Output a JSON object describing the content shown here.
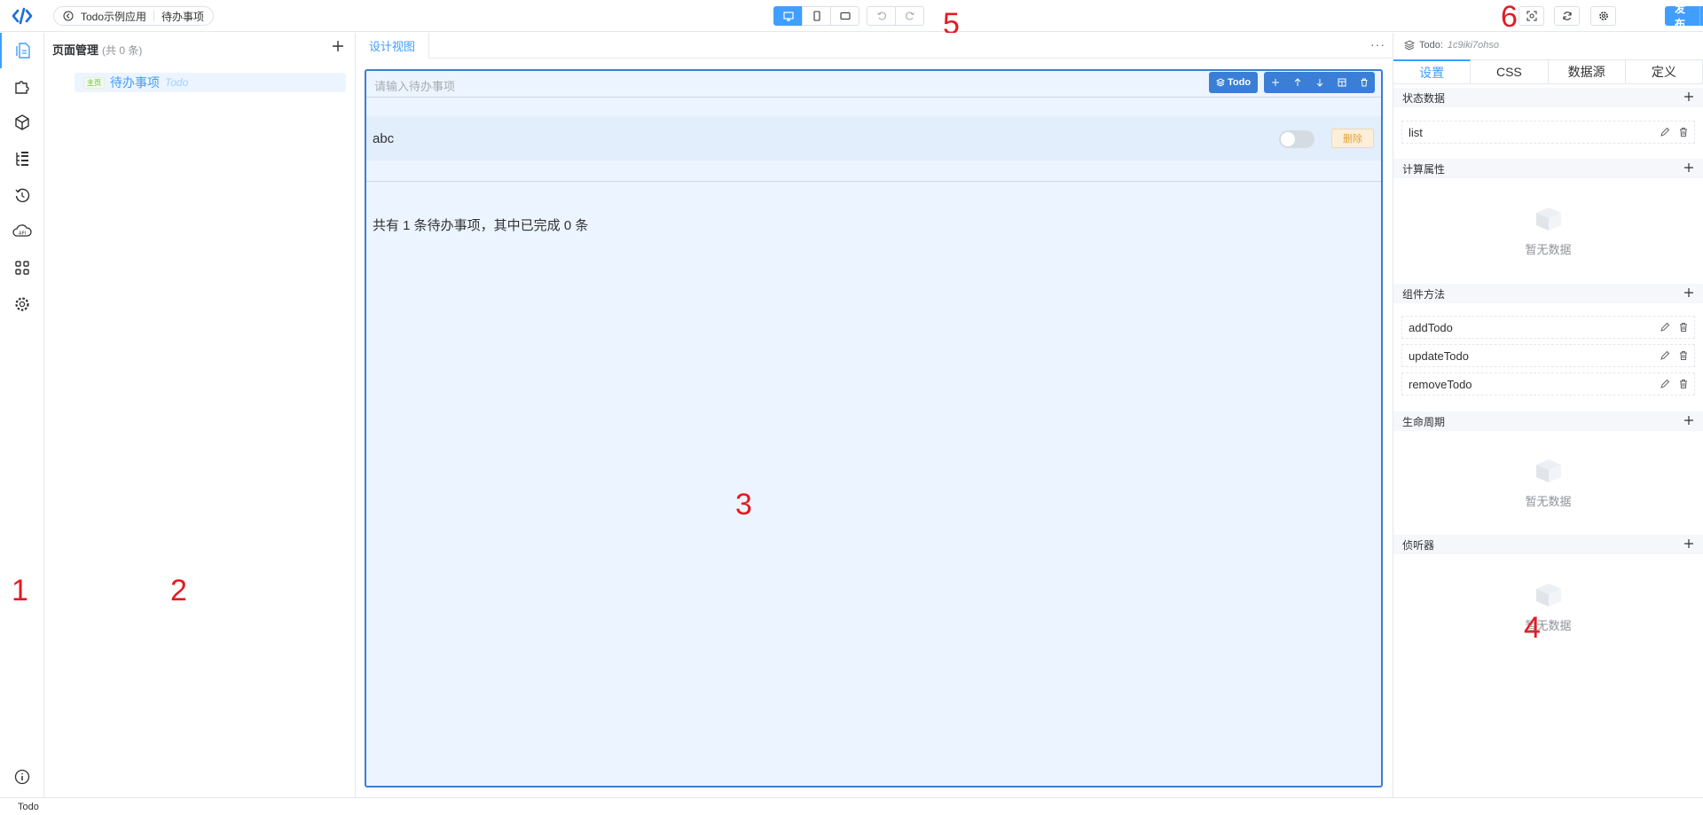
{
  "header": {
    "breadcrumb": {
      "app": "Todo示例应用",
      "page": "待办事项"
    },
    "devices": [
      {
        "name": "desktop",
        "active": true
      },
      {
        "name": "mobile",
        "active": false
      },
      {
        "name": "tablet",
        "active": false
      }
    ],
    "publish_label": "发布",
    "accent": "#409eff"
  },
  "annotations": {
    "n1": "1",
    "n2": "2",
    "n3": "3",
    "n4": "4",
    "n5": "5",
    "n6": "6"
  },
  "sidebar": {
    "icons": [
      "pages-icon",
      "puzzle-icon",
      "cube-icon",
      "tree-list-icon",
      "history-icon",
      "api-cloud-icon",
      "apps-grid-icon",
      "gear-icon"
    ],
    "bottom_icon": "info-icon"
  },
  "pages_panel": {
    "title": "页面管理",
    "count": "(共 0 条)",
    "items": [
      {
        "tag": "主页",
        "name": "待办事项",
        "code": "Todo"
      }
    ]
  },
  "designer": {
    "tab": "设计视图",
    "more": "···",
    "component_label": "Todo",
    "input_placeholder": "请输入待办事项",
    "todos": [
      {
        "title": "abc",
        "done": false,
        "delete_label": "删除"
      }
    ],
    "summary": "共有 1 条待办事项，其中已完成 0 条"
  },
  "properties": {
    "component": "Todo:",
    "component_id": "1c9iki7ohso",
    "tabs": [
      "设置",
      "CSS",
      "数据源",
      "定义"
    ],
    "active_tab": "设置",
    "sections": {
      "state": {
        "title": "状态数据",
        "items": [
          "list"
        ]
      },
      "computed": {
        "title": "计算属性",
        "empty": "暂无数据"
      },
      "methods": {
        "title": "组件方法",
        "items": [
          "addTodo",
          "updateTodo",
          "removeTodo"
        ]
      },
      "lifecycle": {
        "title": "生命周期",
        "empty": "暂无数据"
      },
      "watchers": {
        "title": "侦听器",
        "empty": "暂无数据"
      }
    }
  },
  "status_bar": {
    "text": "Todo"
  }
}
